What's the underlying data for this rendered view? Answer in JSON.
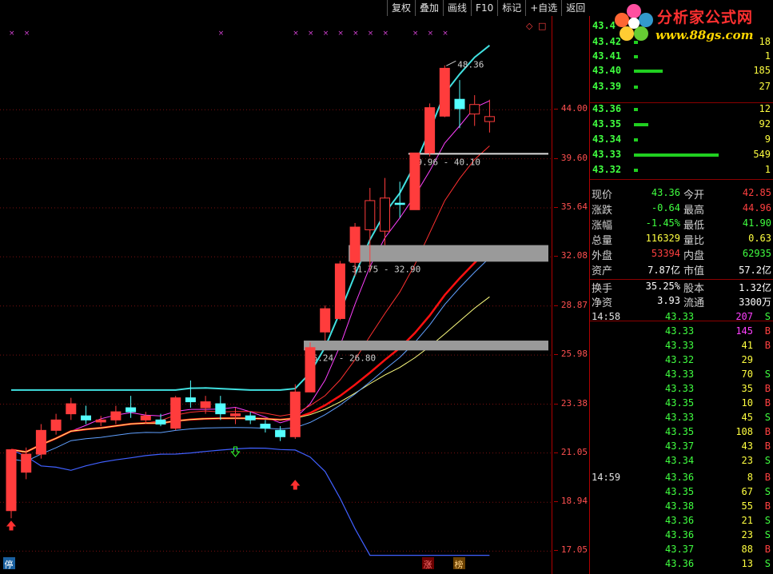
{
  "toolbar": {
    "buttons": [
      "复权",
      "叠加",
      "画线",
      "F10",
      "标记",
      "+自选",
      "返回"
    ]
  },
  "logo": {
    "title": "分析家公式网",
    "url": "www.88gs.com"
  },
  "axis": {
    "ticks": [
      "44.00",
      "39.60",
      "35.64",
      "32.08",
      "28.87",
      "25.98",
      "23.38",
      "21.05",
      "18.94",
      "17.05"
    ]
  },
  "chart": {
    "peak_label": "48.36",
    "zones": [
      {
        "label": "39.96 - 40.10"
      },
      {
        "label": "31.75 - 32.90"
      },
      {
        "label": "26.24 - 26.80"
      }
    ],
    "bottom_badges": [
      "停",
      "涨",
      "榜"
    ],
    "colors": {
      "up": "#ff3c3c",
      "down": "#54ffff",
      "ma_white": "#ffffff"
    }
  },
  "order_book": [
    {
      "price": "43.4",
      "vol": "",
      "bar": 0
    },
    {
      "price": "43.42",
      "vol": "18",
      "bar": 0.02
    },
    {
      "price": "43.41",
      "vol": "1",
      "bar": 0.01
    },
    {
      "price": "43.40",
      "vol": "185",
      "bar": 0.34
    },
    {
      "price": "43.39",
      "vol": "27",
      "bar": 0.05
    },
    {
      "price": "43.36",
      "vol": "12",
      "bar": 0.02
    },
    {
      "price": "43.35",
      "vol": "92",
      "bar": 0.17
    },
    {
      "price": "43.34",
      "vol": "9",
      "bar": 0.02
    },
    {
      "price": "43.33",
      "vol": "549",
      "bar": 1.0
    },
    {
      "price": "43.32",
      "vol": "1",
      "bar": 0.01
    }
  ],
  "quote": [
    {
      "l1": "现价",
      "v1": "43.36",
      "c1": "#40ff40",
      "l2": "今开",
      "v2": "42.85",
      "c2": "#ff4040"
    },
    {
      "l1": "涨跌",
      "v1": "-0.64",
      "c1": "#40ff40",
      "l2": "最高",
      "v2": "44.96",
      "c2": "#ff4040"
    },
    {
      "l1": "涨幅",
      "v1": "-1.45%",
      "c1": "#40ff40",
      "l2": "最低",
      "v2": "41.90",
      "c2": "#40ff40"
    },
    {
      "l1": "总量",
      "v1": "116329",
      "c1": "#ffff40",
      "l2": "量比",
      "v2": "0.63",
      "c2": "#ffff40"
    },
    {
      "l1": "外盘",
      "v1": "53394",
      "c1": "#ff4040",
      "l2": "内盘",
      "v2": "62935",
      "c2": "#40ff40"
    },
    {
      "l1": "资产",
      "v1": "7.87亿",
      "c1": "#ffffff",
      "l2": "市值",
      "v2": "57.2亿",
      "c2": "#ffffff"
    },
    {
      "l1": "换手",
      "v1": "35.25%",
      "c1": "#ffffff",
      "l2": "股本",
      "v2": "1.32亿",
      "c2": "#ffffff"
    },
    {
      "l1": "净资",
      "v1": "3.93",
      "c1": "#ffffff",
      "l2": "流通",
      "v2": "3300万",
      "c2": "#ffffff"
    }
  ],
  "ticks_time": [
    {
      "time": "14:58",
      "price": "43.33",
      "vol": "207",
      "side": "S",
      "vcolor": "#ff40ff"
    },
    {
      "time": "",
      "price": "43.33",
      "vol": "145",
      "side": "B",
      "vcolor": "#ff40ff"
    },
    {
      "time": "",
      "price": "43.33",
      "vol": "41",
      "side": "B",
      "vcolor": "#ffff40"
    },
    {
      "time": "",
      "price": "43.32",
      "vol": "29",
      "side": "",
      "vcolor": "#ffff40"
    },
    {
      "time": "",
      "price": "43.33",
      "vol": "70",
      "side": "S",
      "vcolor": "#ffff40"
    },
    {
      "time": "",
      "price": "43.33",
      "vol": "35",
      "side": "B",
      "vcolor": "#ffff40"
    },
    {
      "time": "",
      "price": "43.35",
      "vol": "10",
      "side": "B",
      "vcolor": "#ffff40"
    },
    {
      "time": "",
      "price": "43.33",
      "vol": "45",
      "side": "S",
      "vcolor": "#ffff40"
    },
    {
      "time": "",
      "price": "43.35",
      "vol": "108",
      "side": "B",
      "vcolor": "#ffff40"
    },
    {
      "time": "",
      "price": "43.37",
      "vol": "43",
      "side": "B",
      "vcolor": "#ffff40"
    },
    {
      "time": "",
      "price": "43.34",
      "vol": "23",
      "side": "S",
      "vcolor": "#ffff40"
    },
    {
      "time": "14:59",
      "price": "43.36",
      "vol": "8",
      "side": "B",
      "vcolor": "#ffff40"
    },
    {
      "time": "",
      "price": "43.35",
      "vol": "67",
      "side": "S",
      "vcolor": "#ffff40"
    },
    {
      "time": "",
      "price": "43.38",
      "vol": "55",
      "side": "B",
      "vcolor": "#ffff40"
    },
    {
      "time": "",
      "price": "43.36",
      "vol": "21",
      "side": "S",
      "vcolor": "#ffff40"
    },
    {
      "time": "",
      "price": "43.36",
      "vol": "23",
      "side": "S",
      "vcolor": "#ffff40"
    },
    {
      "time": "",
      "price": "43.37",
      "vol": "88",
      "side": "B",
      "vcolor": "#ffff40"
    },
    {
      "time": "",
      "price": "43.36",
      "vol": "13",
      "side": "S",
      "vcolor": "#ffff40"
    }
  ],
  "chart_data": {
    "type": "candlestick",
    "y_axis": {
      "scale": "log",
      "ylim": [
        16.6,
        52.0
      ]
    },
    "candles": [
      {
        "o": 18.6,
        "h": 19.3,
        "l": 18.3,
        "c": 21.2,
        "up": true
      },
      {
        "o": 20.2,
        "h": 21.3,
        "l": 19.9,
        "c": 21.0,
        "up": true
      },
      {
        "o": 21.0,
        "h": 22.4,
        "l": 20.8,
        "c": 22.1,
        "up": true
      },
      {
        "o": 22.1,
        "h": 22.9,
        "l": 21.9,
        "c": 22.6,
        "up": true
      },
      {
        "o": 22.9,
        "h": 23.7,
        "l": 22.6,
        "c": 23.4,
        "up": true
      },
      {
        "o": 22.8,
        "h": 23.3,
        "l": 22.4,
        "c": 22.6,
        "up": false
      },
      {
        "o": 22.5,
        "h": 22.8,
        "l": 22.3,
        "c": 22.6,
        "up": true
      },
      {
        "o": 22.6,
        "h": 23.3,
        "l": 22.4,
        "c": 23.0,
        "up": true
      },
      {
        "o": 23.0,
        "h": 23.8,
        "l": 22.7,
        "c": 23.2,
        "up": false
      },
      {
        "o": 22.6,
        "h": 23.0,
        "l": 22.4,
        "c": 22.8,
        "up": true
      },
      {
        "o": 22.6,
        "h": 22.9,
        "l": 22.3,
        "c": 22.4,
        "up": false
      },
      {
        "o": 22.2,
        "h": 23.8,
        "l": 22.1,
        "c": 23.7,
        "up": true
      },
      {
        "o": 23.7,
        "h": 24.6,
        "l": 23.2,
        "c": 23.5,
        "up": false
      },
      {
        "o": 23.5,
        "h": 23.8,
        "l": 22.9,
        "c": 23.2,
        "up": true
      },
      {
        "o": 23.4,
        "h": 23.8,
        "l": 22.6,
        "c": 22.9,
        "up": false
      },
      {
        "o": 22.9,
        "h": 23.2,
        "l": 22.4,
        "c": 22.8,
        "up": true
      },
      {
        "o": 22.8,
        "h": 23.0,
        "l": 22.4,
        "c": 22.6,
        "up": false
      },
      {
        "o": 22.4,
        "h": 22.6,
        "l": 22.0,
        "c": 22.2,
        "up": false
      },
      {
        "o": 22.1,
        "h": 22.3,
        "l": 21.6,
        "c": 21.8,
        "up": false
      },
      {
        "o": 21.8,
        "h": 24.4,
        "l": 21.7,
        "c": 24.0,
        "up": true
      },
      {
        "o": 24.0,
        "h": 26.7,
        "l": 24.0,
        "c": 26.4,
        "up": true
      },
      {
        "o": 27.3,
        "h": 28.9,
        "l": 26.8,
        "c": 28.7,
        "up": true
      },
      {
        "o": 28.1,
        "h": 31.8,
        "l": 28.0,
        "c": 31.6,
        "up": true
      },
      {
        "o": 31.7,
        "h": 34.5,
        "l": 30.8,
        "c": 34.2,
        "up": true
      },
      {
        "o": 34.0,
        "h": 37.2,
        "l": 31.1,
        "c": 36.2,
        "up": true
      },
      {
        "o": 33.9,
        "h": 38.0,
        "l": 32.9,
        "c": 36.4,
        "up": true
      },
      {
        "o": 35.9,
        "h": 37.7,
        "l": 34.9,
        "c": 36.0,
        "up": false
      },
      {
        "o": 35.5,
        "h": 40.1,
        "l": 35.5,
        "c": 40.1,
        "up": true
      },
      {
        "o": 40.1,
        "h": 44.6,
        "l": 39.8,
        "c": 44.2,
        "up": true
      },
      {
        "o": 43.4,
        "h": 48.4,
        "l": 43.3,
        "c": 48.1,
        "up": true
      },
      {
        "o": 45.0,
        "h": 46.9,
        "l": 42.3,
        "c": 44.1,
        "up": false
      },
      {
        "o": 43.6,
        "h": 45.4,
        "l": 42.5,
        "c": 44.5,
        "up": true
      },
      {
        "o": 42.9,
        "h": 44.96,
        "l": 41.9,
        "c": 43.36,
        "up": true
      }
    ]
  }
}
